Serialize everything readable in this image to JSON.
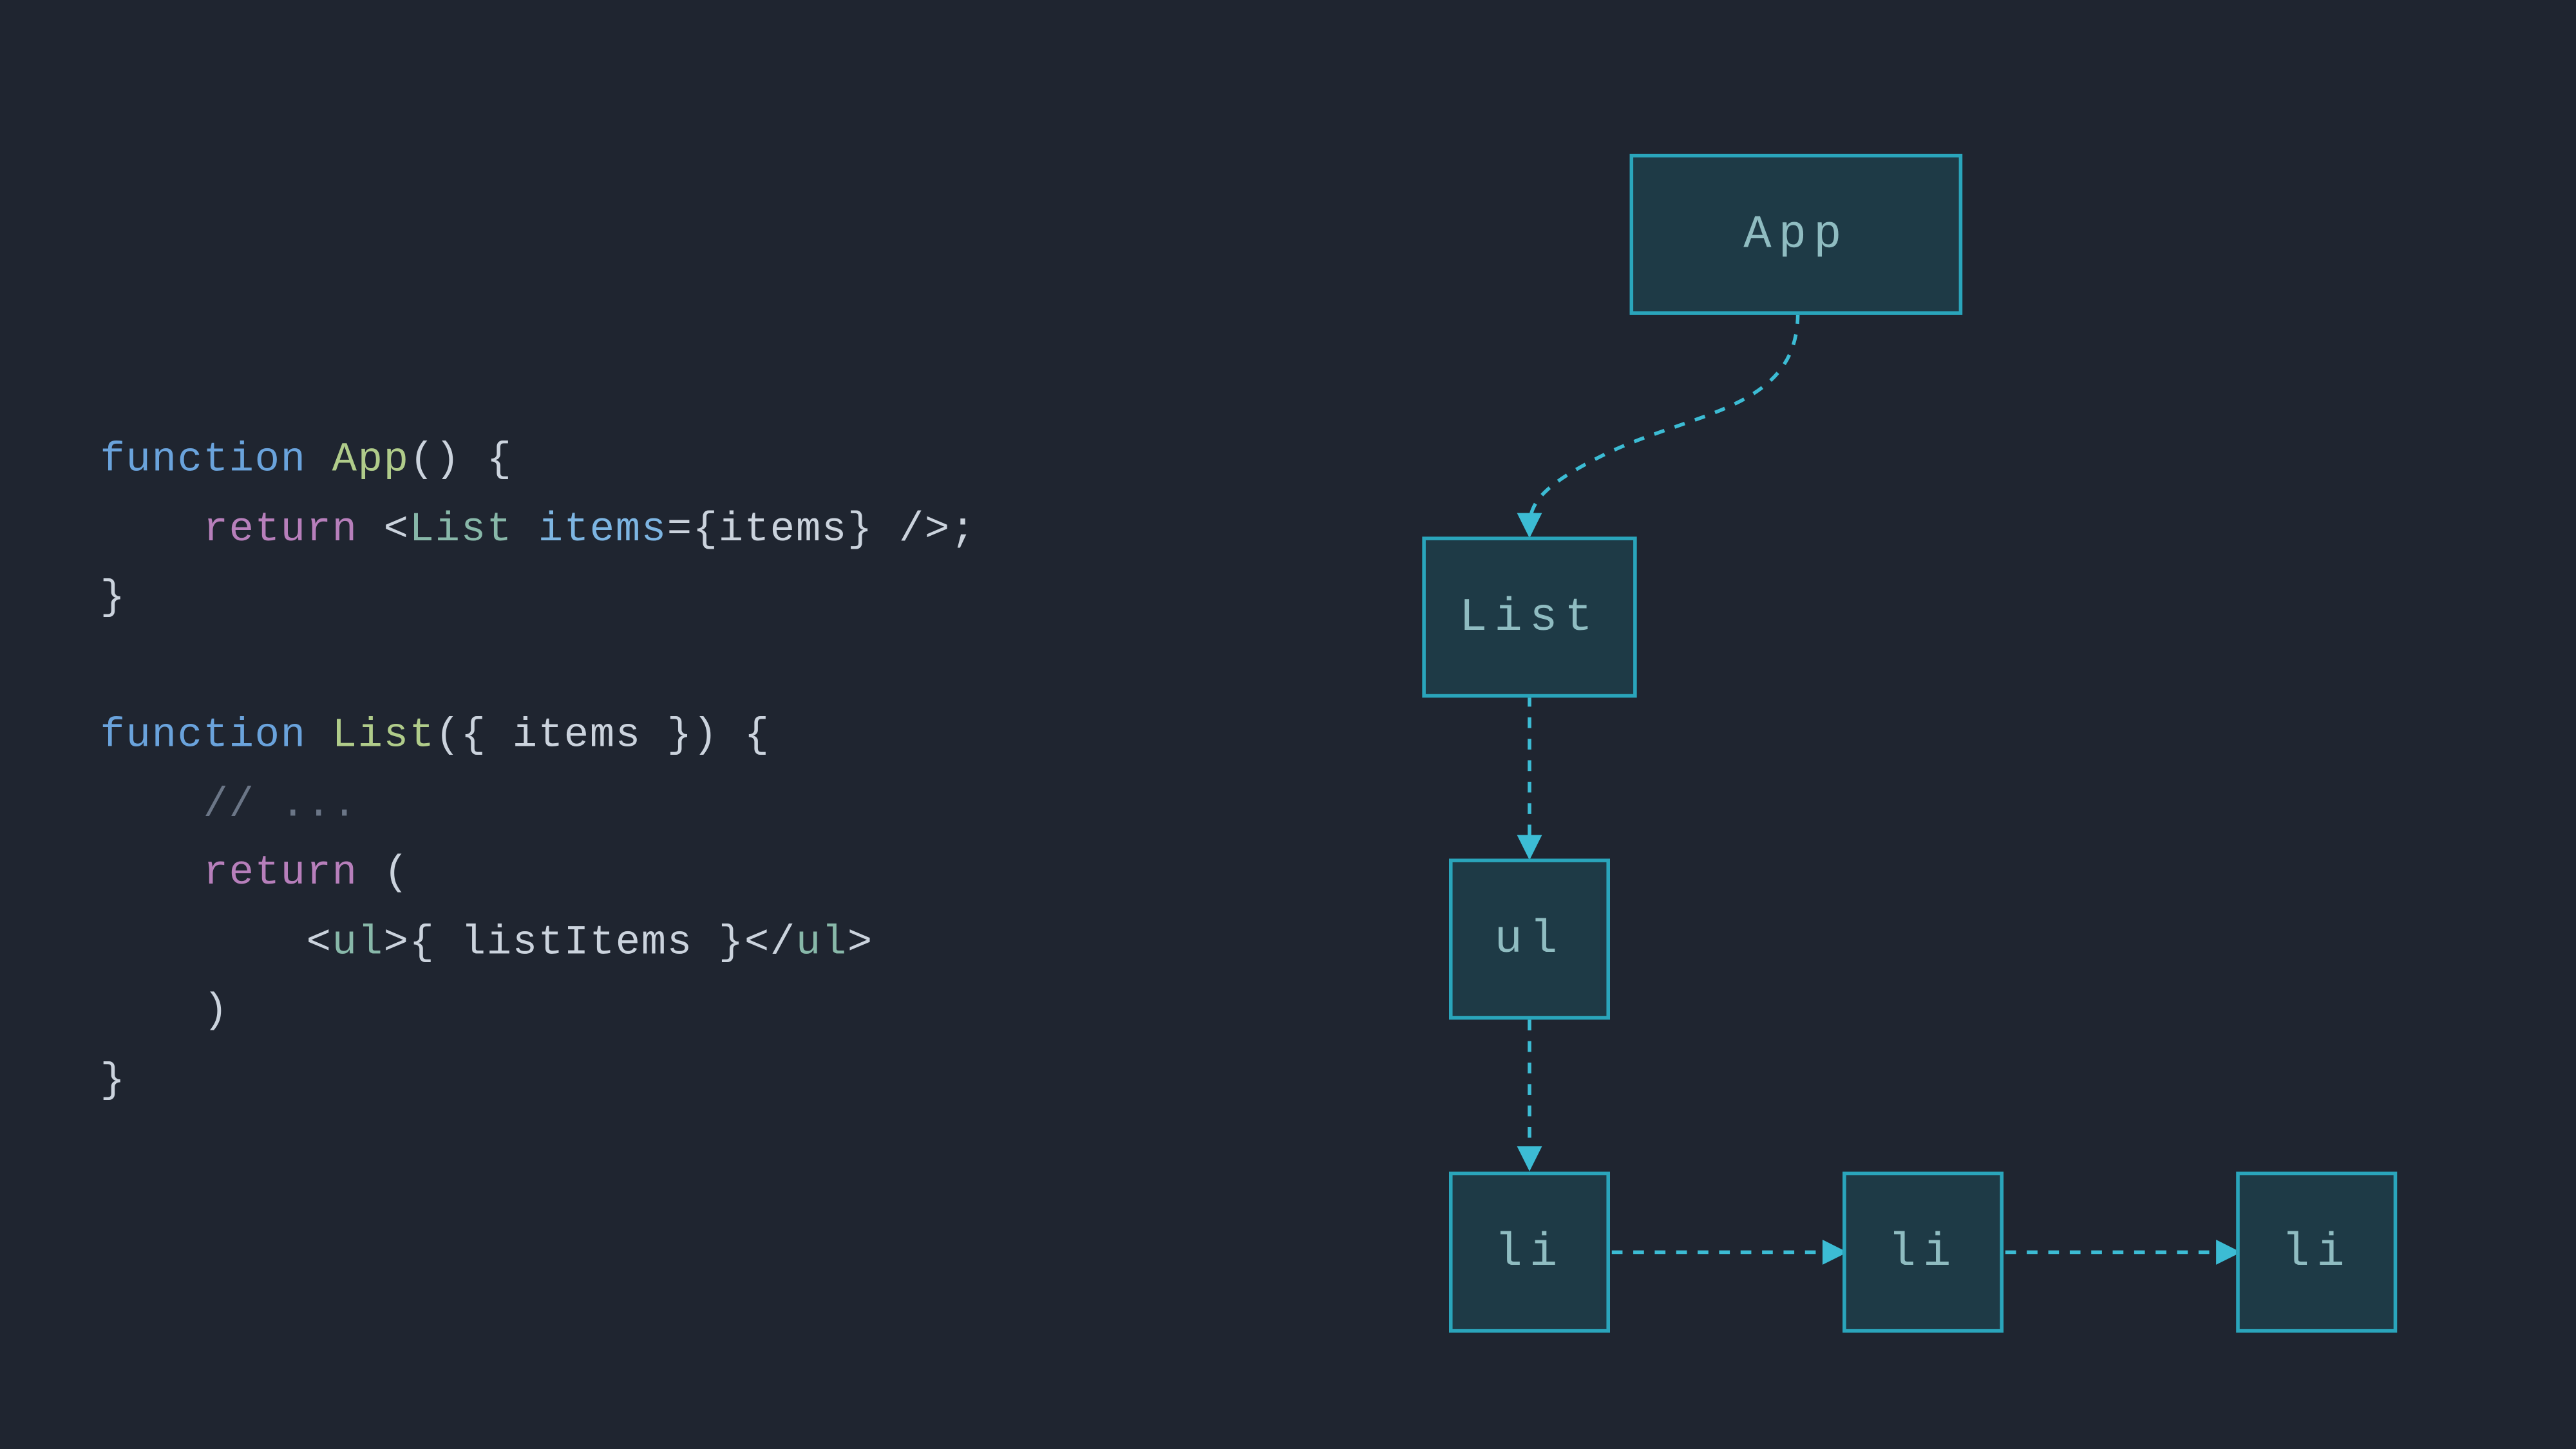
{
  "code": {
    "kw_function1": "function",
    "fn_app": "App",
    "paren_open1": "() {",
    "ret1": "return",
    "lt1": "<",
    "tag_list": "List",
    "attr_items": "items",
    "eq1": "=",
    "brace_open1": "{",
    "id_items": "items",
    "brace_close1": "}",
    "slash_gt": " />",
    "semi1": ";",
    "close_brace1": "}",
    "kw_function2": "function",
    "fn_list": "List",
    "destruct_open": "({ ",
    "param_items": "items",
    "destruct_close": " }) {",
    "comment": "// ...",
    "ret2": "return",
    "paren_open2": " (",
    "lt2": "<",
    "tag_ul_open": "ul",
    "gt2": ">",
    "brace_open2": "{ ",
    "id_listItems": "listItems",
    "brace_close2": " }",
    "lt3": "</",
    "tag_ul_close": "ul",
    "gt3": ">",
    "paren_close2": ")",
    "close_brace2": "}"
  },
  "diagram": {
    "nodes": {
      "app": "App",
      "list": "List",
      "ul": "ul",
      "li1": "li",
      "li2": "li",
      "li3": "li"
    }
  },
  "colors": {
    "bg": "#1f2530",
    "box_border": "#2aa5bb",
    "box_fill": "#1e3a46",
    "box_text": "#8fbcc1",
    "arrow": "#3cbcd4"
  }
}
